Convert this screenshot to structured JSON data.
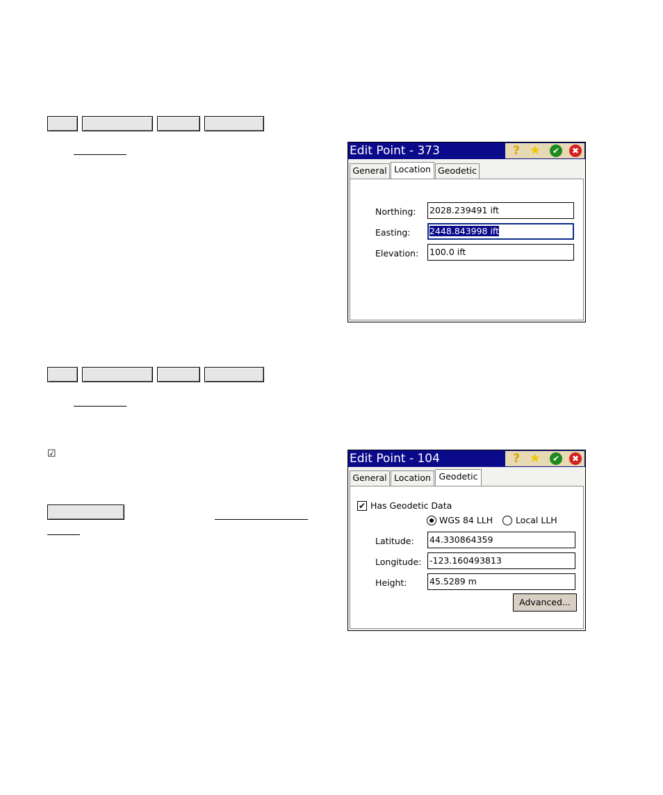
{
  "dialog1": {
    "title": "Edit Point - 373",
    "icons": [
      "help-icon",
      "star-icon",
      "ok-icon",
      "close-icon"
    ],
    "tabs": [
      {
        "label": "General",
        "active": false
      },
      {
        "label": "Location",
        "active": true
      },
      {
        "label": "Geodetic",
        "active": false
      }
    ],
    "fields": [
      {
        "label": "Northing:",
        "value": "2028.239491 ift"
      },
      {
        "label": "Easting:",
        "value": "2448.843998 ift"
      },
      {
        "label": "Elevation:",
        "value": "100.0 ift"
      }
    ]
  },
  "dialog2": {
    "title": "Edit Point - 104",
    "icons": [
      "help-icon",
      "star-icon",
      "ok-icon",
      "close-icon"
    ],
    "tabs": [
      {
        "label": "General",
        "active": false
      },
      {
        "label": "Location",
        "active": false
      },
      {
        "label": "Geodetic",
        "active": true
      }
    ],
    "has_geodetic_label": "Has Geodetic Data",
    "has_geodetic_checked": true,
    "radio_options": [
      {
        "label": "WGS 84 LLH",
        "selected": true
      },
      {
        "label": "Local LLH",
        "selected": false
      }
    ],
    "fields": [
      {
        "label": "Latitude:",
        "value": "44.330864359"
      },
      {
        "label": "Longitude:",
        "value": "-123.160493813"
      },
      {
        "label": "Height:",
        "value": "45.5289 m"
      }
    ],
    "advanced_label": "Advanced..."
  },
  "left": {
    "checkbox_glyph": "☑"
  },
  "colors": {
    "titlebar": "#0a0a8a",
    "icon_area": "#e7d9b3",
    "ok": "#1e8a1e",
    "close": "#d42020"
  }
}
